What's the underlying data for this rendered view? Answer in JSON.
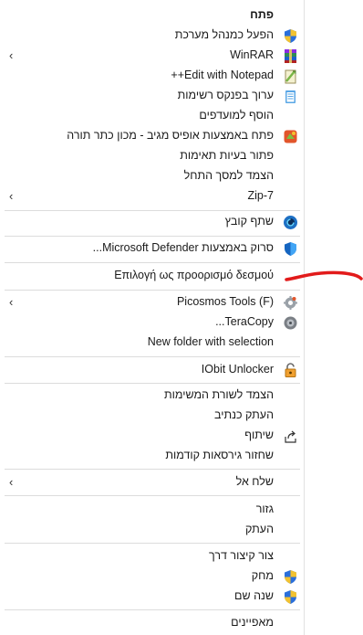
{
  "menu": {
    "items": [
      {
        "label": "פתח",
        "icon": "",
        "submenu": false,
        "bold": true
      },
      {
        "label": "הפעל כמנהל מערכת",
        "icon": "shield-icon",
        "submenu": false
      },
      {
        "label": "WinRAR",
        "icon": "winrar-icon",
        "submenu": true
      },
      {
        "label": "Edit with Notepad++",
        "icon": "notepad-plus-icon",
        "submenu": false
      },
      {
        "label": "ערוך בפנקס רשימות",
        "icon": "notepad-icon",
        "submenu": false
      },
      {
        "label": "הוסף למועדפים",
        "icon": "",
        "submenu": false
      },
      {
        "label": "פתח באמצעות אופיס מגיב - מכון כתר תורה",
        "icon": "office-app-icon",
        "submenu": false
      },
      {
        "label": "פתור בעיות תאימות",
        "icon": "",
        "submenu": false
      },
      {
        "label": "הצמד למסך התחל",
        "icon": "",
        "submenu": false
      },
      {
        "label": "7-Zip",
        "icon": "",
        "submenu": true
      },
      {
        "label": "שתף קובץ",
        "icon": "share-file-icon",
        "submenu": false
      },
      {
        "label": "סרוק באמצעות Microsoft Defender...",
        "icon": "defender-icon",
        "submenu": false
      },
      {
        "label": "Επιλογή ως προορισμό δεσμού",
        "icon": "",
        "submenu": false
      },
      {
        "label": "Picosmos Tools (F)",
        "icon": "picosmos-icon",
        "submenu": true
      },
      {
        "label": "TeraCopy...",
        "icon": "teracopy-icon",
        "submenu": false
      },
      {
        "label": "New folder with selection",
        "icon": "",
        "submenu": false
      },
      {
        "label": "IObit Unlocker",
        "icon": "unlocker-icon",
        "submenu": false
      },
      {
        "label": "הצמד לשורת המשימות",
        "icon": "",
        "submenu": false
      },
      {
        "label": "העתק כנתיב",
        "icon": "",
        "submenu": false
      },
      {
        "label": "שיתוף",
        "icon": "share-icon",
        "submenu": false
      },
      {
        "label": "שחזור גירסאות קודמות",
        "icon": "",
        "submenu": false
      },
      {
        "label": "שלח אל",
        "icon": "",
        "submenu": true
      },
      {
        "label": "גזור",
        "icon": "",
        "submenu": false
      },
      {
        "label": "העתק",
        "icon": "",
        "submenu": false
      },
      {
        "label": "צור קיצור דרך",
        "icon": "",
        "submenu": false
      },
      {
        "label": "מחק",
        "icon": "shield-icon",
        "submenu": false
      },
      {
        "label": "שנה שם",
        "icon": "shield-icon",
        "submenu": false
      },
      {
        "label": "מאפיינים",
        "icon": "",
        "submenu": false
      }
    ]
  },
  "colors": {
    "annotation": "#e21b1b",
    "shield_blue": "#2a6fdb",
    "shield_yellow": "#f2c230"
  }
}
